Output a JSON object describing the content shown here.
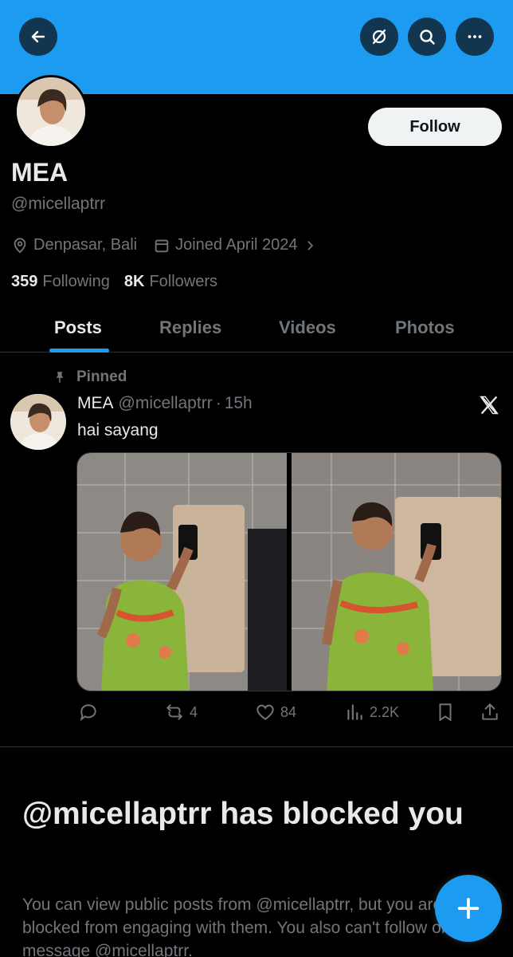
{
  "header": {
    "back_icon": "arrow-left-icon",
    "grok_icon": "circle-slash-icon",
    "search_icon": "search-icon",
    "more_icon": "more-horizontal-icon",
    "banner_color": "#1d9bf0"
  },
  "profile": {
    "name": "MEA",
    "handle": "@micellaptrr",
    "follow_label": "Follow",
    "location": "Denpasar, Bali",
    "joined": "Joined April 2024",
    "following_count": "359",
    "following_label": "Following",
    "followers_count": "8K",
    "followers_label": "Followers"
  },
  "tabs": [
    {
      "label": "Posts",
      "active": true
    },
    {
      "label": "Replies",
      "active": false
    },
    {
      "label": "Videos",
      "active": false
    },
    {
      "label": "Photos",
      "active": false
    }
  ],
  "post": {
    "pinned_label": "Pinned",
    "author_name": "MEA",
    "author_handle": "@micellaptrr",
    "separator": "·",
    "time": "15h",
    "text": "hai sayang",
    "reply_count": "",
    "repost_count": "4",
    "like_count": "84",
    "view_count": "2.2K"
  },
  "blocked": {
    "title": "@micellaptrr has blocked you",
    "description": "You can view public posts from @micellaptrr, but you are blocked from engaging with them. You also can't follow or message @micellaptrr."
  },
  "fab": {
    "icon": "plus-icon"
  },
  "colors": {
    "accent": "#1d9bf0",
    "muted": "#71767b",
    "text": "#e7e9ea",
    "background": "#000000"
  }
}
